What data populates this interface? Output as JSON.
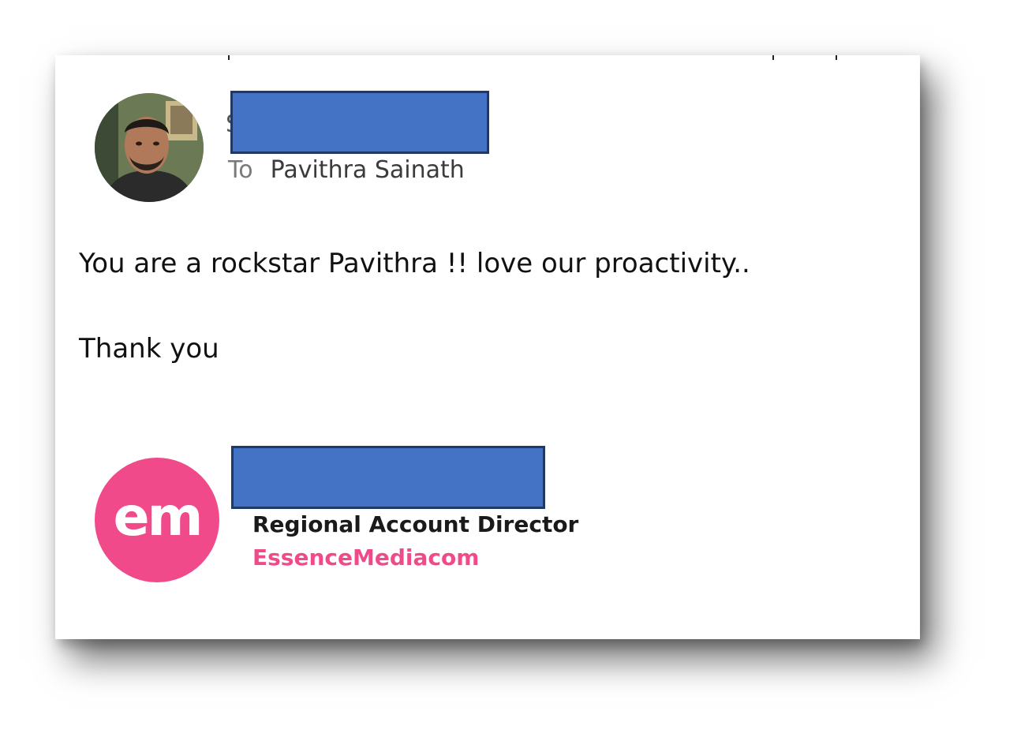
{
  "email": {
    "sender_initial": "S",
    "to_label": "To",
    "recipient": "Pavithra Sainath",
    "body_line1": "You are a rockstar Pavithra !! love our proactivity..",
    "body_line2": "Thank you"
  },
  "signature": {
    "logo_text": "em",
    "title": "Regional Account Director",
    "company": "EssenceMediacom"
  },
  "colors": {
    "redaction_fill": "#4472c4",
    "redaction_border": "#1f3864",
    "brand_pink": "#f14a8a"
  }
}
